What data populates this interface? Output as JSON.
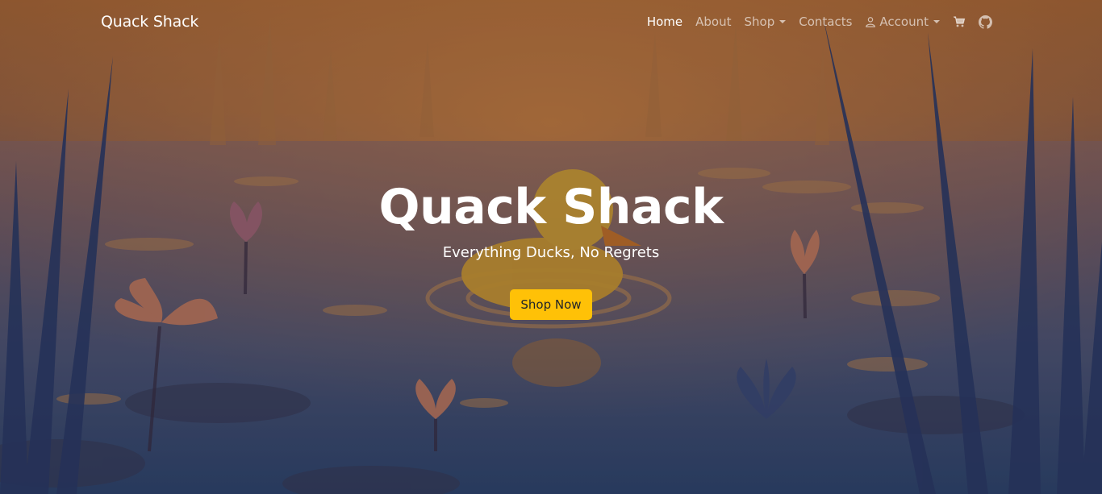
{
  "navbar": {
    "brand": "Quack Shack",
    "items": [
      {
        "label": "Home",
        "active": true
      },
      {
        "label": "About"
      },
      {
        "label": "Shop",
        "dropdown": true
      },
      {
        "label": "Contacts"
      },
      {
        "label": "Account",
        "dropdown": true,
        "icon": "person-icon"
      }
    ],
    "icons": [
      "cart-icon",
      "github-icon"
    ]
  },
  "hero": {
    "title": "Quack Shack",
    "subtitle": "Everything Ducks, No Regrets",
    "button_label": "Shop Now"
  },
  "colors": {
    "accent": "#ffc107",
    "nav_text_active": "#ffffff",
    "nav_text": "#c8c0c0"
  }
}
